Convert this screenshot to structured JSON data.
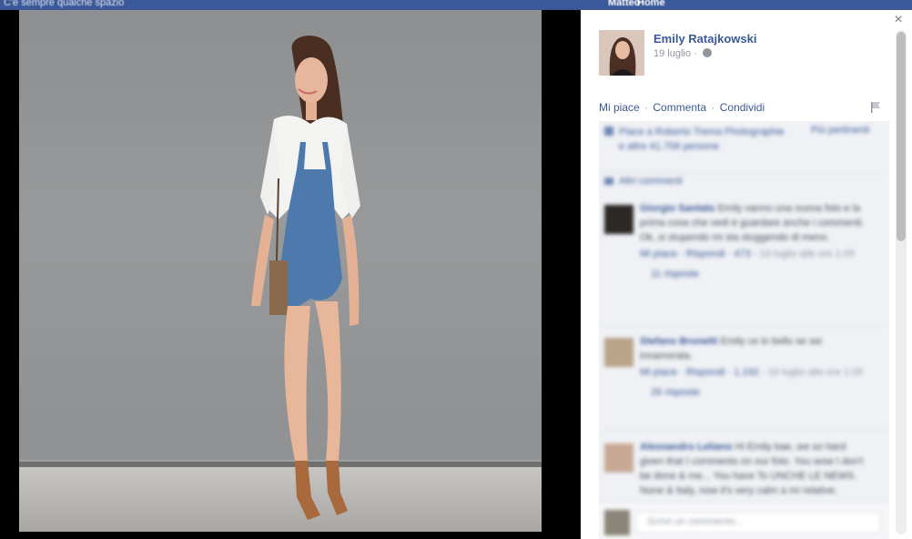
{
  "background_bar": {
    "left_text": "C'è sempre qualche spazio",
    "right_text_1": "Matteo",
    "right_text_2": "Home"
  },
  "post": {
    "author": "Emily Ratajkowski",
    "date": "19 luglio",
    "separator": "·",
    "privacy_icon": "globe-icon",
    "actions": {
      "like": "Mi piace",
      "comment": "Commenta",
      "share": "Condividi"
    },
    "report_icon": "flag-icon",
    "close_icon": "close-icon",
    "close_glyph": "×"
  },
  "comments_section": {
    "likes_summary": "Piace a Roberto Trema Photographie e altre 41.758 persone",
    "most_relevant": "Più pertinenti",
    "view_previous": "Altri commenti",
    "comments": [
      {
        "name": "Giorgio Santato",
        "text": "Emily vanno una nuova foto e la prima cosa che vedi è guardare anche i commenti. Ok, si stupendo mi sta stuggendo di meno.",
        "like": "Mi piace",
        "reply": "Rispondi",
        "likes": "473",
        "time": "19 luglio alle ore 1:05",
        "replies": "11 risposte"
      },
      {
        "name": "Stefano Brunetti",
        "text": "Emily ce lo bello se sei innamorata.",
        "like": "Mi piace",
        "reply": "Rispondi",
        "likes": "1.192",
        "time": "19 luglio alle ore 1:05",
        "replies": "26 risposte"
      },
      {
        "name": "Alessandro Leliano",
        "text": "Hi Emily bae, we so hard given that I comments on our foto. You wow I don't be done & me... You have To UNCHE LE NEWS. None & Italy, now it's very calm a mi relative.",
        "like": "",
        "reply": "",
        "likes": "",
        "time": "",
        "replies": ""
      }
    ],
    "compose_placeholder": "Scrivi un commento..."
  }
}
